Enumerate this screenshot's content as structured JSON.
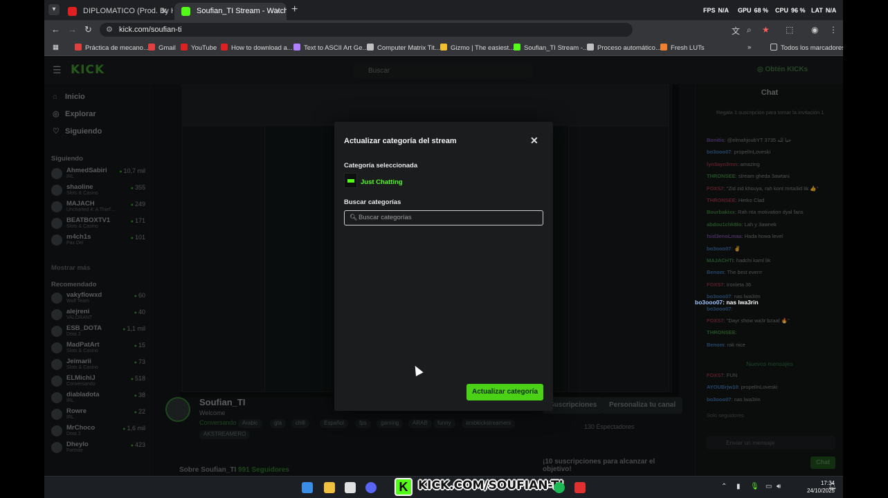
{
  "browser": {
    "tabs": [
      {
        "title": "DIPLOMATICO (Prod. By Hazer)",
        "color": "#e02020"
      },
      {
        "title": "Soufian_TI Stream - Watch Live",
        "color": "#53fc18"
      }
    ],
    "hud": {
      "fps_label": "FPS",
      "fps": "N/A",
      "gpu_label": "GPU",
      "gpu": "68 %",
      "cpu_label": "CPU",
      "cpu": "96 %",
      "lat_label": "LAT",
      "lat": "N/A"
    },
    "url": "kick.com/soufian-ti",
    "bookmarks": [
      {
        "label": "Práctica de mecano...",
        "color": "#e04040"
      },
      {
        "label": "Gmail",
        "color": "#e04040"
      },
      {
        "label": "YouTube",
        "color": "#e02020"
      },
      {
        "label": "How to download a...",
        "color": "#e02020"
      },
      {
        "label": "Text to ASCII Art Ge...",
        "color": "#b080ff"
      },
      {
        "label": "Computer Matrix Tit...",
        "color": "#c0c0c0"
      },
      {
        "label": "Gizmo | The easiest...",
        "color": "#f0c030"
      },
      {
        "label": "Soufian_TI Stream -...",
        "color": "#53fc18"
      },
      {
        "label": "Proceso automático...",
        "color": "#c0c0c0"
      },
      {
        "label": "Fresh LUTs",
        "color": "#f08030"
      }
    ],
    "all_bookmarks": "Todos los marcadores"
  },
  "kick": {
    "logo": "KICK",
    "search_placeholder": "Buscar",
    "get_kicks": "Obtén KICKs",
    "nav": [
      {
        "icon": "home-icon",
        "label": "Inicio"
      },
      {
        "icon": "compass-icon",
        "label": "Explorar"
      },
      {
        "icon": "heart-icon",
        "label": "Siguiendo"
      }
    ],
    "following_header": "Siguiendo",
    "following": [
      {
        "name": "AhmedSabiri",
        "sub": "IRL",
        "viewers": "10,7 mil"
      },
      {
        "name": "shaoline",
        "sub": "Slots & Casino",
        "viewers": "355"
      },
      {
        "name": "MAJACH",
        "sub": "Uncharted 4: A Thief'...",
        "viewers": "249"
      },
      {
        "name": "BEATBOXTV1",
        "sub": "Slots & Casino",
        "viewers": "171"
      },
      {
        "name": "m4ch1s",
        "sub": "Pax Dei",
        "viewers": "101"
      }
    ],
    "show_more": "Mostrar más",
    "recommended_header": "Recomendado",
    "recommended": [
      {
        "name": "vakyflowxd",
        "sub": "Wolf Team",
        "viewers": "60"
      },
      {
        "name": "alejreni",
        "sub": "VALORANT",
        "viewers": "40"
      },
      {
        "name": "ESB_DOTA",
        "sub": "Dota 2",
        "viewers": "1,1 mil"
      },
      {
        "name": "MadPatArt",
        "sub": "Slots & Casino",
        "viewers": "15"
      },
      {
        "name": "Jeimarii",
        "sub": "Slots & Casino",
        "viewers": "73"
      },
      {
        "name": "ELMichiJ",
        "sub": "Conversando",
        "viewers": "518"
      },
      {
        "name": "diabladota",
        "sub": "IRL",
        "viewers": "38"
      },
      {
        "name": "Rowre",
        "sub": "IRL",
        "viewers": "22"
      },
      {
        "name": "MrChoco",
        "sub": "Dota 2",
        "viewers": "1,6 mil"
      },
      {
        "name": "Dheylo",
        "sub": "Fortnite",
        "viewers": "423"
      }
    ],
    "streamer": {
      "name": "Soufian_TI",
      "title": "Welcome",
      "category": "Conversando",
      "tags": [
        "Arabic",
        "gta",
        "chill",
        "Español",
        "fps",
        "gaming",
        "ARAB",
        "funny",
        "arabkickstreamers"
      ],
      "tag2": "AKSTREAMERO",
      "viewers": "130 Espectadores",
      "subs_btn": "Suscripciones",
      "customize_btn": "Personaliza tu canal",
      "about": "Sobre Soufian_TI",
      "followers": "991 Seguidores",
      "subgoal": "¡10 suscripciones para alcanzar el objetivo!"
    },
    "chat": {
      "title": "Chat",
      "gift_notice": "Regala 1 suscripción para tomar la invitación 1",
      "messages": [
        {
          "user": "Bonitis",
          "text": "@elmahjoubYT 3735 حيا لله",
          "cls": "pu"
        },
        {
          "user": "bo3ooo07",
          "text": "propelInLoveski",
          "cls": ""
        },
        {
          "user": "lyn3ayn3rnn",
          "text": "amazing",
          "cls": "pk"
        },
        {
          "user": "THRONSEE",
          "text": "stream gheda 3awtani",
          "cls": "gr"
        },
        {
          "user": "FOXS7",
          "text": "\"Zid zid khouya, rah kont mrta3id lik 👍\"",
          "cls": "pk"
        },
        {
          "user": "THRONSEE",
          "text": "Herko Clad",
          "cls": "pk"
        },
        {
          "user": "Bourbakixx",
          "text": "Rah nta motivation dyal fans",
          "cls": "gr"
        },
        {
          "user": "abdou1chk8lo",
          "text": "Lah y 3awnek",
          "cls": "gr"
        },
        {
          "user": "fsid3enoLmaa",
          "text": "Hada howa level",
          "cls": "pu"
        },
        {
          "user": "bo3ooo07",
          "text": "✌",
          "cls": ""
        },
        {
          "user": "MAJACHTI",
          "text": "hadchi kaml lik",
          "cls": "gr"
        },
        {
          "user": "Benom",
          "text": "The best everrr",
          "cls": ""
        },
        {
          "user": "FOXS7",
          "text": "Ironleta 36",
          "cls": "pk"
        },
        {
          "user": "bo3ooo07",
          "text": "nas lwa3rin",
          "cls": ""
        },
        {
          "user": "bo3ooo07",
          "text": "",
          "cls": ""
        },
        {
          "user": "FOXS7",
          "text": "\"Dayr show wa3r bzaaf 🔥\"",
          "cls": "pk"
        },
        {
          "user": "THRONSEE",
          "text": "",
          "cls": "gr"
        },
        {
          "user": "Benom",
          "text": "rak nice",
          "cls": ""
        },
        {
          "user": "FOXS7",
          "text": "FUN",
          "cls": "pk"
        },
        {
          "user": "AYOUBrjw10",
          "text": "propelInLoveski",
          "cls": ""
        },
        {
          "user": "bo3ooo07",
          "text": "nas lwa3rin",
          "cls": ""
        }
      ],
      "highlight_user": "bo3ooo07",
      "highlight_text": "nas lwa3rin",
      "new_messages": "Nuevos mensajes",
      "subs_only": "Solo seguidores",
      "input_placeholder": "Enviar un mensaje",
      "send": "Chat"
    }
  },
  "modal": {
    "title": "Actualizar categoría del stream",
    "selected_label": "Categoría seleccionada",
    "selected_category": "Just Chatting",
    "search_label": "Buscar categorías",
    "search_placeholder": "Buscar categorías",
    "submit": "Actualizar categoría",
    "accent": "#53fc18"
  },
  "taskbar": {
    "watermark": "KICK.COM/SOUFIAN-TI",
    "time": "17:34",
    "date": "24/10/2025"
  }
}
